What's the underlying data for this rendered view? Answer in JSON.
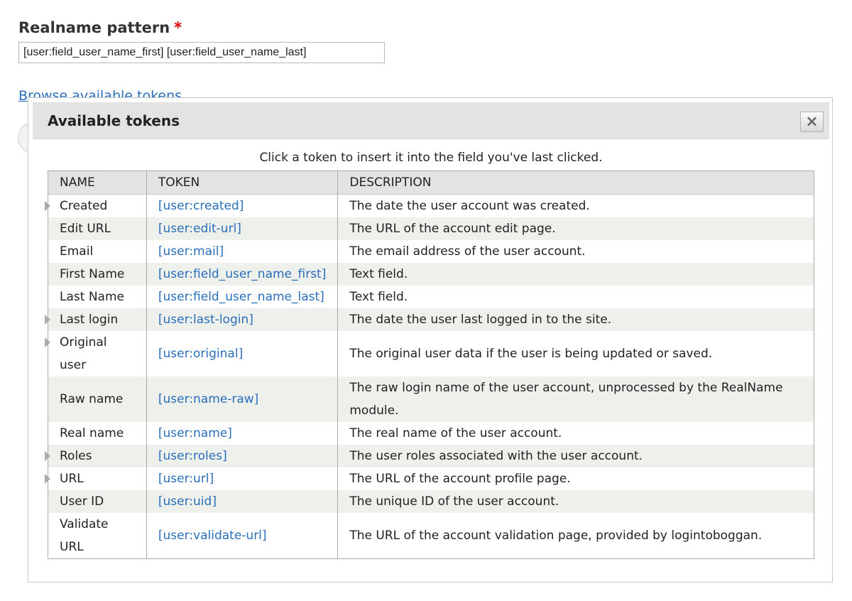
{
  "form": {
    "label": "Realname pattern",
    "required_marker": "*",
    "pattern_value": "[user:field_user_name_first] [user:field_user_name_last]",
    "browse_link": "Browse available tokens"
  },
  "dialog": {
    "title": "Available tokens",
    "close_icon": "×",
    "help_text": "Click a token to insert it into the field you've last clicked.",
    "columns": [
      "NAME",
      "TOKEN",
      "DESCRIPTION"
    ],
    "rows": [
      {
        "name": "Created",
        "token": "[user:created]",
        "description": "The date the user account was created.",
        "expandable": true
      },
      {
        "name": "Edit URL",
        "token": "[user:edit-url]",
        "description": "The URL of the account edit page.",
        "expandable": false
      },
      {
        "name": "Email",
        "token": "[user:mail]",
        "description": "The email address of the user account.",
        "expandable": false
      },
      {
        "name": "First Name",
        "token": "[user:field_user_name_first]",
        "description": "Text field.",
        "expandable": false
      },
      {
        "name": "Last Name",
        "token": "[user:field_user_name_last]",
        "description": "Text field.",
        "expandable": false
      },
      {
        "name": "Last login",
        "token": "[user:last-login]",
        "description": "The date the user last logged in to the site.",
        "expandable": true
      },
      {
        "name": "Original user",
        "token": "[user:original]",
        "description": "The original user data if the user is being updated or saved.",
        "expandable": true
      },
      {
        "name": "Raw name",
        "token": "[user:name-raw]",
        "description": "The raw login name of the user account, unprocessed by the RealName module.",
        "expandable": false
      },
      {
        "name": "Real name",
        "token": "[user:name]",
        "description": "The real name of the user account.",
        "expandable": false
      },
      {
        "name": "Roles",
        "token": "[user:roles]",
        "description": "The user roles associated with the user account.",
        "expandable": true
      },
      {
        "name": "URL",
        "token": "[user:url]",
        "description": "The URL of the account profile page.",
        "expandable": true
      },
      {
        "name": "User ID",
        "token": "[user:uid]",
        "description": "The unique ID of the user account.",
        "expandable": false
      },
      {
        "name": "Validate URL",
        "token": "[user:validate-url]",
        "description": "The URL of the account validation page, provided by logintoboggan.",
        "expandable": false
      }
    ]
  }
}
